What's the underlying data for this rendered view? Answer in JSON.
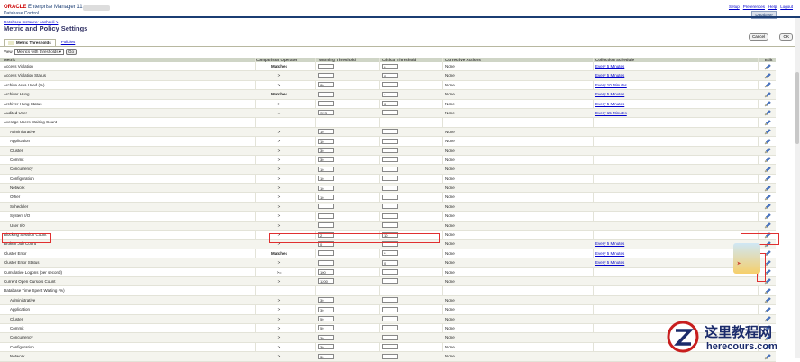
{
  "header": {
    "oracle": "ORACLE",
    "product": "Enterprise Manager 11 g",
    "subtitle": "Database Control",
    "links": [
      "Setup",
      "Preferences",
      "Help",
      "Logout"
    ],
    "db_tab": "Database"
  },
  "breadcrumb": "Database Instance: oashsuli >",
  "page_title": "Metric and Policy Settings",
  "buttons": {
    "cancel": "Cancel",
    "ok": "OK"
  },
  "tabs": {
    "metric_thresholds": "Metric Thresholds",
    "policies": "Policies"
  },
  "view": {
    "label": "View",
    "selected": "Metrics with thresholds",
    "go": "Go"
  },
  "columns": [
    "Metric",
    "Comparison Operator",
    "Warning Threshold",
    "Critical Threshold",
    "Corrective Actions",
    "Collection Schedule",
    "Edit"
  ],
  "rows": [
    {
      "metric": "Access Violation",
      "op": "Matches",
      "warn": "",
      "crit": "*",
      "ca": "None",
      "sched": "Every 5 Minutes",
      "edit": true
    },
    {
      "metric": "Access Violation Status",
      "op": ">",
      "warn": "",
      "crit": "0",
      "ca": "None",
      "sched": "Every 5 Minutes",
      "edit": true
    },
    {
      "metric": "Archive Area Used (%)",
      "op": ">",
      "warn": "80",
      "crit": "",
      "ca": "None",
      "sched": "Every 10 Minutes",
      "edit": true
    },
    {
      "metric": "Archiver Hung",
      "op": "Matches",
      "warn": "",
      "crit": "*",
      "ca": "None",
      "sched": "Every 5 Minutes",
      "edit": true
    },
    {
      "metric": "Archiver Hung Status",
      "op": ">",
      "warn": "",
      "crit": "0",
      "ca": "None",
      "sched": "Every 5 Minutes",
      "edit": true
    },
    {
      "metric": "Audited User",
      "op": "=",
      "warn": "SYS",
      "crit": "",
      "ca": "None",
      "sched": "Every 15 Minutes",
      "edit": true
    },
    {
      "metric": "Average Users Waiting Count",
      "group": true,
      "edit": true
    },
    {
      "metric": "Administrative",
      "sub": true,
      "op": ">",
      "warn": "10",
      "crit": "",
      "ca": "None",
      "sched": "",
      "edit": true
    },
    {
      "metric": "Application",
      "sub": true,
      "op": ">",
      "warn": "10",
      "crit": "",
      "ca": "None",
      "sched": "",
      "edit": true
    },
    {
      "metric": "Cluster",
      "sub": true,
      "op": ">",
      "warn": "30",
      "crit": "",
      "ca": "None",
      "sched": "",
      "edit": true
    },
    {
      "metric": "Commit",
      "sub": true,
      "op": ">",
      "warn": "30",
      "crit": "",
      "ca": "None",
      "sched": "",
      "edit": true
    },
    {
      "metric": "Concurrency",
      "sub": true,
      "op": ">",
      "warn": "10",
      "crit": "",
      "ca": "None",
      "sched": "",
      "edit": true
    },
    {
      "metric": "Configuration",
      "sub": true,
      "op": ">",
      "warn": "10",
      "crit": "",
      "ca": "None",
      "sched": "",
      "edit": true
    },
    {
      "metric": "Network",
      "sub": true,
      "op": ">",
      "warn": "10",
      "crit": "",
      "ca": "None",
      "sched": "",
      "edit": true
    },
    {
      "metric": "Other",
      "sub": true,
      "op": ">",
      "warn": "10",
      "crit": "",
      "ca": "None",
      "sched": "",
      "edit": true
    },
    {
      "metric": "Scheduler",
      "sub": true,
      "op": ">",
      "warn": "",
      "crit": "",
      "ca": "None",
      "sched": "",
      "edit": true
    },
    {
      "metric": "System I/O",
      "sub": true,
      "op": ">",
      "warn": "",
      "crit": "",
      "ca": "None",
      "sched": "",
      "edit": true
    },
    {
      "metric": "User I/O",
      "sub": true,
      "op": ">",
      "warn": "",
      "crit": "",
      "ca": "None",
      "sched": "",
      "edit": true
    },
    {
      "metric": "Blocking Session Count",
      "op": ">",
      "warn": "2",
      "crit": "10",
      "ca": "None",
      "sched": "",
      "edit": true
    },
    {
      "metric": "Broken Job Count",
      "op": ">",
      "warn": "0",
      "crit": "",
      "ca": "None",
      "sched": "Every 5 Minutes",
      "edit": true
    },
    {
      "metric": "Cluster Error",
      "op": "Matches",
      "warn": "",
      "crit": "*",
      "ca": "None",
      "sched": "Every 5 Minutes",
      "edit": true
    },
    {
      "metric": "Cluster Error Status",
      "op": ">",
      "warn": "",
      "crit": "0",
      "ca": "None",
      "sched": "Every 5 Minutes",
      "edit": true
    },
    {
      "metric": "Cumulative Logons (per second)",
      "op": ">=",
      "warn": "100",
      "crit": "",
      "ca": "None",
      "sched": "",
      "edit": true
    },
    {
      "metric": "Current Open Cursors Count",
      "op": ">",
      "warn": "1200",
      "crit": "",
      "ca": "None",
      "sched": "",
      "edit": true
    },
    {
      "metric": "Database Time Spent Waiting (%)",
      "group": true,
      "edit": true
    },
    {
      "metric": "Administrative",
      "sub": true,
      "op": ">",
      "warn": "30",
      "crit": "",
      "ca": "None",
      "sched": "",
      "edit": true
    },
    {
      "metric": "Application",
      "sub": true,
      "op": ">",
      "warn": "30",
      "crit": "",
      "ca": "None",
      "sched": "",
      "edit": true
    },
    {
      "metric": "Cluster",
      "sub": true,
      "op": ">",
      "warn": "50",
      "crit": "",
      "ca": "None",
      "sched": "",
      "edit": true
    },
    {
      "metric": "Commit",
      "sub": true,
      "op": ">",
      "warn": "50",
      "crit": "",
      "ca": "None",
      "sched": "",
      "edit": true
    },
    {
      "metric": "Concurrency",
      "sub": true,
      "op": ">",
      "warn": "30",
      "crit": "",
      "ca": "None",
      "sched": "",
      "edit": true
    },
    {
      "metric": "Configuration",
      "sub": true,
      "op": ">",
      "warn": "30",
      "crit": "",
      "ca": "None",
      "sched": "",
      "edit": true
    },
    {
      "metric": "Network",
      "sub": true,
      "op": ">",
      "warn": "30",
      "crit": "",
      "ca": "None",
      "sched": "",
      "edit": true
    }
  ],
  "watermark": {
    "cn": "这里教程网",
    "en": "herecours.com"
  },
  "colors": {
    "brand_red": "#c00000",
    "nav_blue": "#1b3d73",
    "header_bg": "#cfd5c6",
    "highlight": "#e03030",
    "link": "#0000cc"
  }
}
